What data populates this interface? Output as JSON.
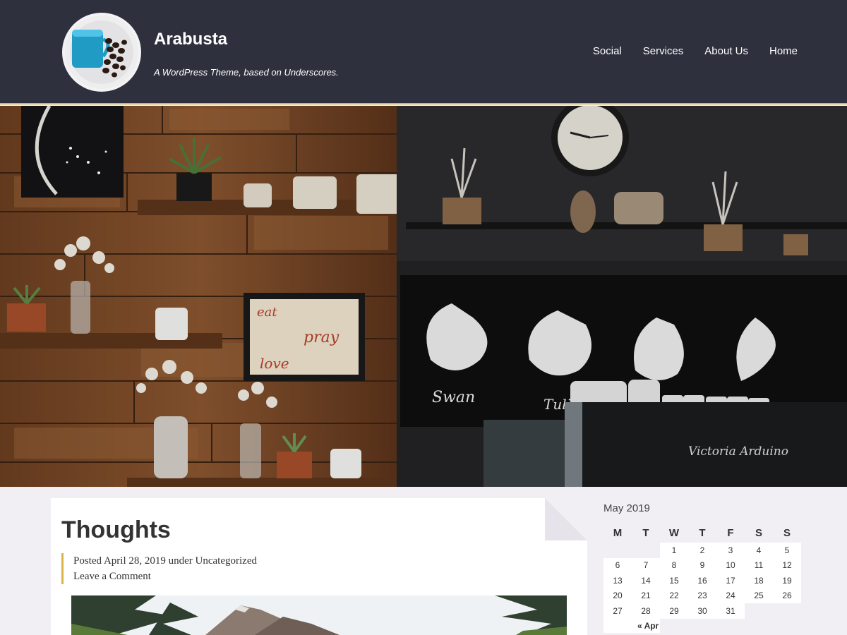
{
  "site": {
    "title": "Arabusta",
    "description": "A WordPress Theme, based on Underscores."
  },
  "nav": {
    "items": [
      "Social",
      "Services",
      "About Us",
      "Home"
    ]
  },
  "hero": {
    "sign_labels": [
      "Swan",
      "Tuli"
    ],
    "machine_brand": "Victoria Arduino",
    "frame_words": [
      "eat",
      "pray",
      "love"
    ]
  },
  "post": {
    "title": "Thoughts",
    "posted_prefix": "Posted",
    "date": "April 28, 2019",
    "under": "under",
    "category": "Uncategorized",
    "comment_link": "Leave a Comment"
  },
  "calendar": {
    "caption": "May 2019",
    "weekdays": [
      "M",
      "T",
      "W",
      "T",
      "F",
      "S",
      "S"
    ],
    "weeks": [
      [
        "",
        "",
        "1",
        "2",
        "3",
        "4",
        "5"
      ],
      [
        "6",
        "7",
        "8",
        "9",
        "10",
        "11",
        "12"
      ],
      [
        "13",
        "14",
        "15",
        "16",
        "17",
        "18",
        "19"
      ],
      [
        "20",
        "21",
        "22",
        "23",
        "24",
        "25",
        "26"
      ],
      [
        "27",
        "28",
        "29",
        "30",
        "31",
        "",
        ""
      ]
    ],
    "prev_link": "« Apr"
  },
  "colors": {
    "header_bg": "#2e303d",
    "accent": "#d9b54a",
    "page_bg": "#f1eff4"
  }
}
